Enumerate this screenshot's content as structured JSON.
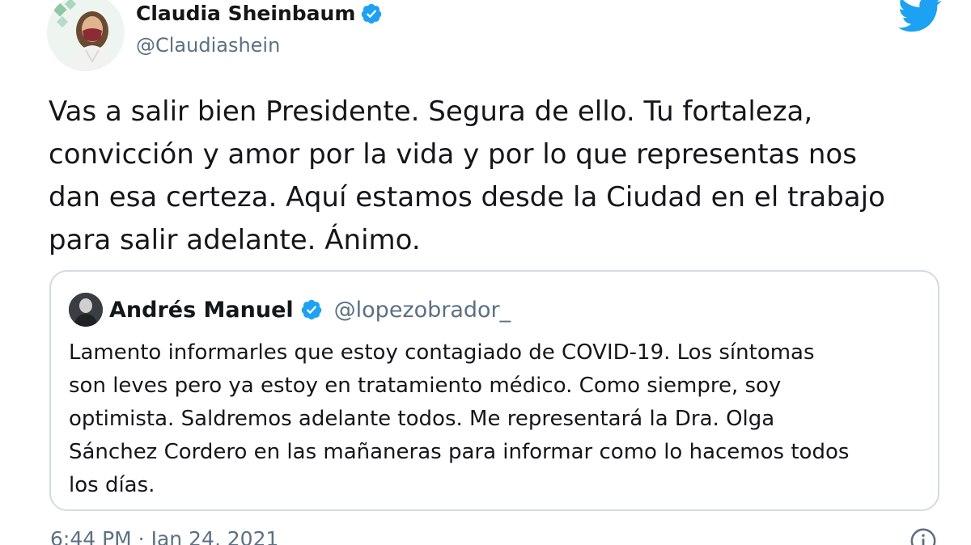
{
  "author": {
    "display_name": "Claudia Sheinbaum",
    "handle": "@Claudiashein",
    "verified": true,
    "avatar_icon": "profile-photo"
  },
  "brand": {
    "icon": "twitter-bird-icon",
    "color": "#1da1f2"
  },
  "tweet": {
    "lines": [
      "Vas a salir bien Presidente. Segura de ello. Tu fortaleza,",
      "convicción y amor por la vida y por lo que representas nos",
      "dan esa certeza. Aquí estamos desde la Ciudad en el trabajo",
      "para salir adelante. Ánimo."
    ]
  },
  "quoted_tweet": {
    "display_name": "Andrés Manuel",
    "handle": "@lopezobrador_",
    "verified": true,
    "lines": [
      "Lamento informarles que estoy contagiado de COVID-19. Los síntomas",
      "son leves pero ya estoy en tratamiento médico. Como siempre, soy",
      "optimista. Saldremos adelante todos. Me representará la Dra. Olga",
      "Sánchez Cordero en las mañaneras para informar como lo hacemos todos",
      "los días."
    ]
  },
  "footer": {
    "timestamp": "6:44 PM · Jan 24, 2021",
    "info_icon": "info-icon"
  },
  "colors": {
    "text_primary": "#14171a",
    "text_secondary": "#5b7083",
    "border": "#d2dbe1",
    "verified_badge": "#1da1f2"
  }
}
